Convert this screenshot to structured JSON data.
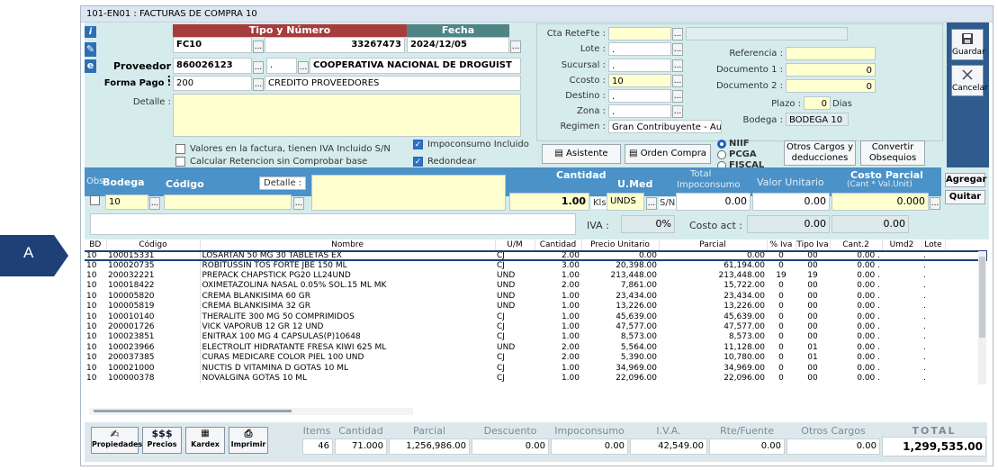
{
  "window": {
    "title": "101-EN01 : FACTURAS DE COMPRA 10"
  },
  "header": {
    "tipo_numero_label": "Tipo y Número",
    "fecha_label": "Fecha",
    "tipo": "FC10",
    "numero": "33267473",
    "fecha": "2024/12/05",
    "proveedor_label": "Proveedor :",
    "proveedor_nit": "860026123",
    "proveedor_dv": ".",
    "proveedor_nombre": "COOPERATIVA NACIONAL DE DROGUIST",
    "forma_pago_label": "Forma Pago :",
    "forma_pago_code": "200",
    "forma_pago_desc": "CREDITO PROVEEDORES",
    "detalle_label": "Detalle :"
  },
  "right": {
    "cta_retefte_label": "Cta ReteFte :",
    "lote_label": "Lote :",
    "lote_value": ".",
    "sucursal_label": "Sucursal :",
    "sucursal_value": ".",
    "ccosto_label": "Ccosto :",
    "ccosto_value": "10",
    "destino_label": "Destino :",
    "destino_value": ".",
    "zona_label": "Zona :",
    "zona_value": ".",
    "regimen_label": "Regimen :",
    "regimen_value": "Gran Contribuyente - Auto",
    "referencia_label": "Referencia :",
    "documento1_label": "Documento 1 :",
    "documento1_value": "0",
    "documento2_label": "Documento 2 :",
    "documento2_value": "0",
    "plazo_label": "Plazo :",
    "plazo_value": "0",
    "dias_label": "Dias",
    "bodega_label": "Bodega :",
    "bodega_value": "BODEGA 10"
  },
  "sidebar": {
    "guardar": "Guardar",
    "cancelar": "Cancelar"
  },
  "options": {
    "iva_incluido": "Valores en la factura, tienen  IVA Incluido S/N",
    "calcular_retencion": "Calcular Retencion sin Comprobar base",
    "impoconsumo_incluido": "Impoconsumo Incluido",
    "redondear": "Redondear",
    "asistente": "Asistente",
    "orden_compra": "Orden Compra",
    "niif": "NIIF",
    "pcga": "PCGA",
    "fiscal": "FISCAL",
    "otros_cargos": "Otros Cargos y deducciones",
    "convertir_obsequios": "Convertir Obsequios"
  },
  "item_entry": {
    "obs_label": "Obs",
    "bodega_label": "Bodega",
    "codigo_label": "Código",
    "detalle_label": "Detalle :",
    "cantidad_label": "Cantidad",
    "umed_label": "U.Med",
    "total_impoconsumo_label_1": "Total",
    "total_impoconsumo_label_2": "Impoconsumo",
    "valor_unitario_label": "Valor Unitario",
    "costo_parcial_label": "Costo Parcial",
    "costo_parcial_sub": "(Cant * Val.Unit)",
    "bodega_value": "10",
    "cantidad_value": "1.00",
    "kls": "Kls",
    "umed_value": "UNDS",
    "sn": "S/N",
    "impoconsumo_value": "0.00",
    "valor_unitario_value": "0.00",
    "costo_parcial_value": "0.000",
    "iva_label": "IVA :",
    "iva_value": "0%",
    "costo_act_label": "Costo act :",
    "costo_act_value": "0.00",
    "extra_value": "0.00",
    "agregar": "Agregar",
    "quitar": "Quitar"
  },
  "grid": {
    "columns": [
      "BD",
      "Código",
      "Nombre",
      "U/M",
      "Cantidad",
      "Precio Unitario",
      "Parcial",
      "% Iva",
      "Tipo Iva",
      "Cant.2",
      "Umd2",
      "Lote"
    ],
    "rows": [
      [
        "10",
        "100015331",
        "LOSARTAN 50 MG 30 TABLETAS EX",
        "CJ",
        "2.00",
        "0.00",
        "0.00",
        "0",
        "00",
        "0.00 .",
        "",
        "."
      ],
      [
        "10",
        "100020735",
        "ROBITUSSIN TOS FORTE JBE 150 ML",
        "CJ",
        "3.00",
        "20,398.00",
        "61,194.00",
        "0",
        "00",
        "0.00 .",
        "",
        "."
      ],
      [
        "10",
        "200032221",
        "PREPACK CHAPSTICK PG20 LL24UND",
        "UND",
        "1.00",
        "213,448.00",
        "213,448.00",
        "19",
        "19",
        "0.00 .",
        "",
        "."
      ],
      [
        "10",
        "100018422",
        "OXIMETAZOLINA NASAL 0.05% SOL.15 ML MK",
        "UND",
        "2.00",
        "7,861.00",
        "15,722.00",
        "0",
        "00",
        "0.00 .",
        "",
        "."
      ],
      [
        "10",
        "100005820",
        "CREMA BLANKISIMA 60 GR",
        "UND",
        "1.00",
        "23,434.00",
        "23,434.00",
        "0",
        "00",
        "0.00 .",
        "",
        "."
      ],
      [
        "10",
        "100005819",
        "CREMA BLANKISIMA 32 GR",
        "UND",
        "1.00",
        "13,226.00",
        "13,226.00",
        "0",
        "00",
        "0.00 .",
        "",
        "."
      ],
      [
        "10",
        "100010140",
        "THERALITE 300 MG 50 COMPRIMIDOS",
        "CJ",
        "1.00",
        "45,639.00",
        "45,639.00",
        "0",
        "00",
        "0.00 .",
        "",
        "."
      ],
      [
        "10",
        "200001726",
        "VICK VAPORUB 12 GR 12 UND",
        "CJ",
        "1.00",
        "47,577.00",
        "47,577.00",
        "0",
        "00",
        "0.00 .",
        "",
        "."
      ],
      [
        "10",
        "100023851",
        "ENITRAX 100 MG 4 CAPSULAS(P)10648",
        "CJ",
        "1.00",
        "8,573.00",
        "8,573.00",
        "0",
        "00",
        "0.00 .",
        "",
        "."
      ],
      [
        "10",
        "100023966",
        "ELECTROLIT HIDRATANTE FRESA KIWI 625 ML",
        "UND",
        "2.00",
        "5,564.00",
        "11,128.00",
        "0",
        "01",
        "0.00 .",
        "",
        "."
      ],
      [
        "10",
        "200037385",
        "CURAS MEDICARE COLOR PIEL 100 UND",
        "CJ",
        "2.00",
        "5,390.00",
        "10,780.00",
        "0",
        "01",
        "0.00 .",
        "",
        "."
      ],
      [
        "10",
        "100021000",
        "NUCTIS D VITAMINA D GOTAS 10 ML",
        "CJ",
        "1.00",
        "34,969.00",
        "34,969.00",
        "0",
        "00",
        "0.00 .",
        "",
        "."
      ],
      [
        "10",
        "100000378",
        "NOVALGINA GOTAS 10 ML",
        "CJ",
        "1.00",
        "22,096.00",
        "22,096.00",
        "0",
        "00",
        "0.00 .",
        "",
        "."
      ]
    ]
  },
  "totals": {
    "items_label": "Items",
    "cantidad_label": "Cantidad",
    "parcial_label": "Parcial",
    "descuento_label": "Descuento",
    "impoconsumo_label": "Impoconsumo",
    "iva_label": "I.V.A.",
    "rtefuente_label": "Rte/Fuente",
    "otros_label": "Otros Cargos Deduc",
    "total_label": "TOTAL",
    "items": "46",
    "cantidad": "71.000",
    "parcial": "1,256,986.00",
    "descuento": "0.00",
    "impoconsumo": "0.00",
    "iva": "42,549.00",
    "rtefuente": "0.00",
    "otros": "0.00",
    "total": "1,299,535.00"
  },
  "bottom_buttons": {
    "propiedades": "Propiedades",
    "precios_icon": "$$$",
    "precios": "Precios",
    "kardex": "Kardex",
    "imprimir": "Imprimir"
  },
  "annotation": {
    "label": "A",
    "color": "#1f3f77"
  }
}
